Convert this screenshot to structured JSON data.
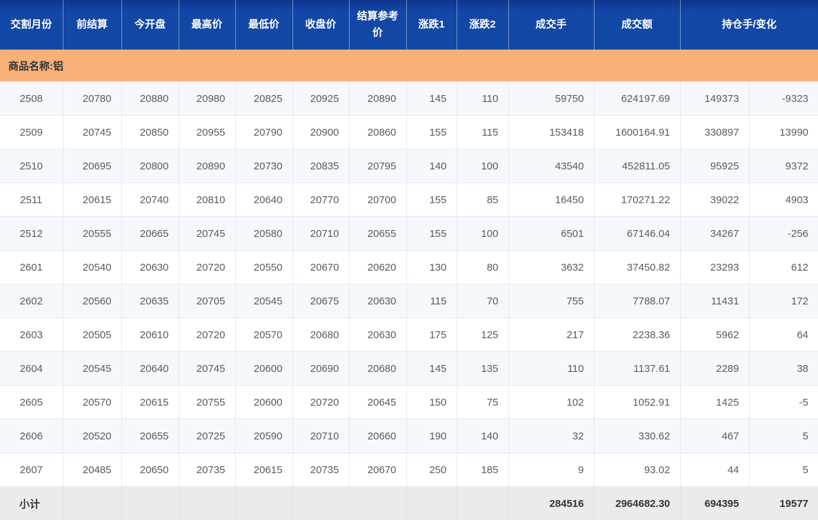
{
  "table": {
    "columns": [
      {
        "label": "交割月份"
      },
      {
        "label": "前结算"
      },
      {
        "label": "今开盘"
      },
      {
        "label": "最高价"
      },
      {
        "label": "最低价"
      },
      {
        "label": "收盘价"
      },
      {
        "label": "结算参考价"
      },
      {
        "label": "涨跌1"
      },
      {
        "label": "涨跌2"
      },
      {
        "label": "成交手"
      },
      {
        "label": "成交额"
      },
      {
        "label": "持仓手/变化"
      }
    ],
    "group_label": "商品名称:铝",
    "rows": [
      [
        "2508",
        "20780",
        "20880",
        "20980",
        "20825",
        "20925",
        "20890",
        "145",
        "110",
        "59750",
        "624197.69",
        "149373",
        "-9323"
      ],
      [
        "2509",
        "20745",
        "20850",
        "20955",
        "20790",
        "20900",
        "20860",
        "155",
        "115",
        "153418",
        "1600164.91",
        "330897",
        "13990"
      ],
      [
        "2510",
        "20695",
        "20800",
        "20890",
        "20730",
        "20835",
        "20795",
        "140",
        "100",
        "43540",
        "452811.05",
        "95925",
        "9372"
      ],
      [
        "2511",
        "20615",
        "20740",
        "20810",
        "20640",
        "20770",
        "20700",
        "155",
        "85",
        "16450",
        "170271.22",
        "39022",
        "4903"
      ],
      [
        "2512",
        "20555",
        "20665",
        "20745",
        "20580",
        "20710",
        "20655",
        "155",
        "100",
        "6501",
        "67146.04",
        "34267",
        "-256"
      ],
      [
        "2601",
        "20540",
        "20630",
        "20720",
        "20550",
        "20670",
        "20620",
        "130",
        "80",
        "3632",
        "37450.82",
        "23293",
        "612"
      ],
      [
        "2602",
        "20560",
        "20635",
        "20705",
        "20545",
        "20675",
        "20630",
        "115",
        "70",
        "755",
        "7788.07",
        "11431",
        "172"
      ],
      [
        "2603",
        "20505",
        "20610",
        "20720",
        "20570",
        "20680",
        "20630",
        "175",
        "125",
        "217",
        "2238.36",
        "5962",
        "64"
      ],
      [
        "2604",
        "20545",
        "20640",
        "20745",
        "20600",
        "20690",
        "20680",
        "145",
        "135",
        "110",
        "1137.61",
        "2289",
        "38"
      ],
      [
        "2605",
        "20570",
        "20615",
        "20755",
        "20600",
        "20720",
        "20645",
        "150",
        "75",
        "102",
        "1052.91",
        "1425",
        "-5"
      ],
      [
        "2606",
        "20520",
        "20655",
        "20725",
        "20590",
        "20710",
        "20660",
        "190",
        "140",
        "32",
        "330.62",
        "467",
        "5"
      ],
      [
        "2607",
        "20485",
        "20650",
        "20735",
        "20615",
        "20735",
        "20670",
        "250",
        "185",
        "9",
        "93.02",
        "44",
        "5"
      ]
    ],
    "subtotal": {
      "label": "小计",
      "volume": "284516",
      "turnover": "2964682.30",
      "open_interest": "694395",
      "oi_change": "19577"
    }
  },
  "colors": {
    "header_bg": "#1347a5",
    "group_bg": "#f9b178",
    "stripe_bg": "#f5f8fc",
    "footer_bg": "#ebebeb",
    "header_text": "#ffffff",
    "data_text": "#565b64"
  }
}
